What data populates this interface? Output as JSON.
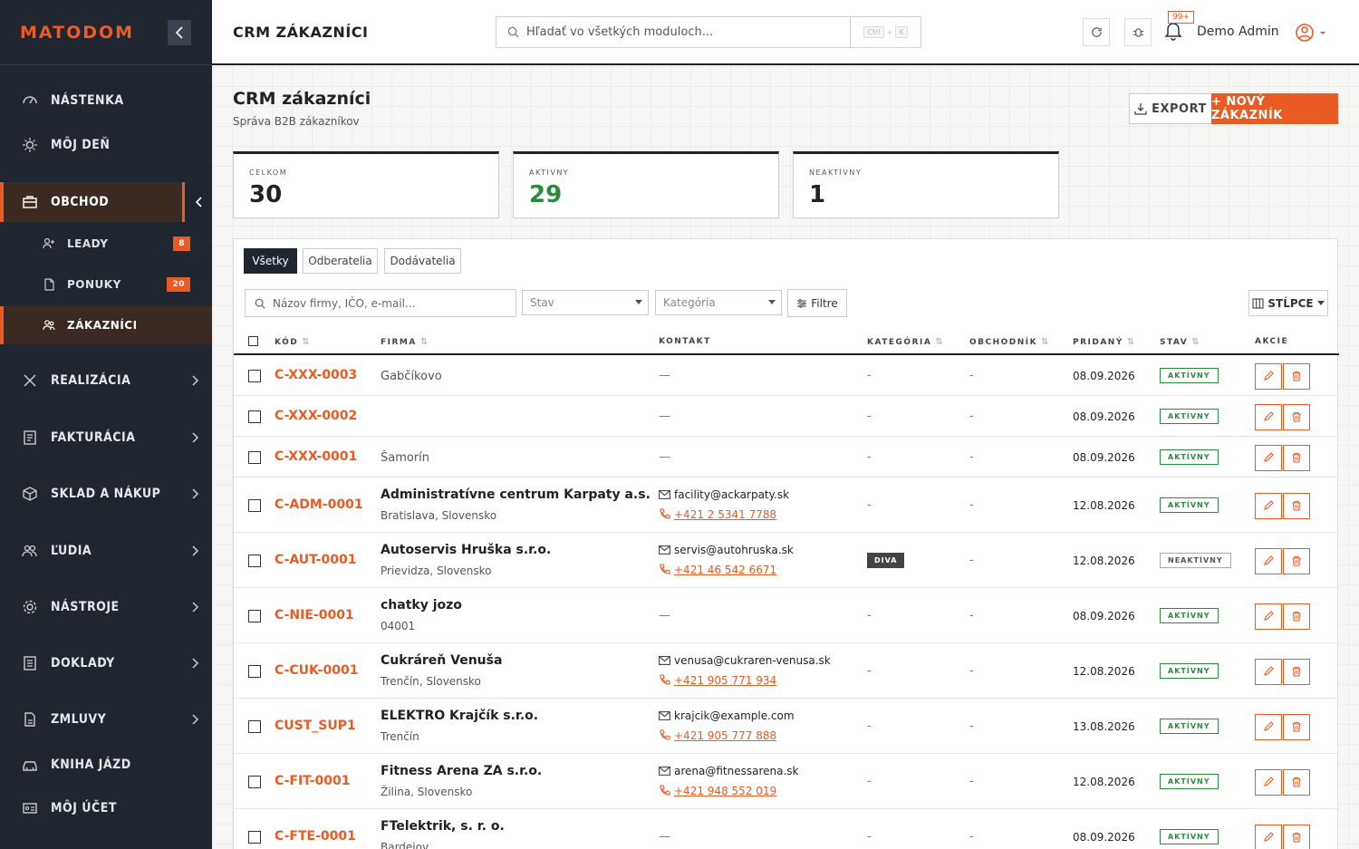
{
  "app": {
    "logo": "MATODOM",
    "topbar_title": "CRM ZÁKAZNÍCI",
    "search_placeholder": "Hľadať vo všetkých moduloch...",
    "shortcut_ctrl": "Ctrl",
    "shortcut_plus": "+",
    "shortcut_key": "K",
    "notifications": "99+",
    "user_name": "Demo Admin"
  },
  "sidebar": {
    "items": [
      {
        "label": "NÁSTENKA",
        "icon": "dashboard-icon"
      },
      {
        "label": "MÔJ DEŇ",
        "icon": "sun-icon"
      },
      {
        "label": "OBCHOD",
        "icon": "briefcase-icon"
      },
      {
        "label": "REALIZÁCIA",
        "icon": "tools-icon"
      },
      {
        "label": "FAKTURÁCIA",
        "icon": "invoice-icon"
      },
      {
        "label": "SKLAD A NÁKUP",
        "icon": "box-icon"
      },
      {
        "label": "ĽUDIA",
        "icon": "people-icon"
      },
      {
        "label": "NÁSTROJE",
        "icon": "gear-icon"
      },
      {
        "label": "DOKLADY",
        "icon": "document-icon"
      },
      {
        "label": "ZMLUVY",
        "icon": "contract-icon"
      },
      {
        "label": "KNIHA JÁZD",
        "icon": "car-icon"
      },
      {
        "label": "MÔJ ÚČET",
        "icon": "id-card-icon"
      }
    ],
    "sub_items": [
      {
        "label": "LEADY",
        "badge": "8"
      },
      {
        "label": "PONUKY",
        "badge": "20"
      },
      {
        "label": "ZÁKAZNÍCI"
      }
    ]
  },
  "header": {
    "title": "CRM zákazníci",
    "subtitle": "Správa B2B zákazníkov",
    "export_label": "EXPORT",
    "new_label": "+ NOVÝ ZÁKAZNÍK"
  },
  "stats": [
    {
      "label": "CELKOM",
      "value": "30",
      "color": "#222222"
    },
    {
      "label": "AKTÍVNY",
      "value": "29",
      "color": "#2b8a3e"
    },
    {
      "label": "NEAKTÍVNY",
      "value": "1",
      "color": "#222222"
    }
  ],
  "tabs": [
    "Všetky",
    "Odberatelia",
    "Dodávatelia"
  ],
  "filters": {
    "search_placeholder": "Názov firmy, IČO, e-mail...",
    "status_placeholder": "Stav",
    "category_placeholder": "Kategória",
    "filter_label": "Filtre",
    "columns_label": "STĹPCE"
  },
  "table": {
    "headers": [
      "KÓD",
      "FIRMA",
      "KONTAKT",
      "KATEGÓRIA",
      "OBCHODNÍK",
      "PRIDANÝ",
      "STAV",
      "AKCIE"
    ],
    "rows": [
      {
        "code": "C-XXX-0003",
        "firm": "Gabčíkovo",
        "firm_sub": "",
        "email": "",
        "phone": "",
        "contact": "—",
        "category": "-",
        "agent": "-",
        "date": "08.09.2026",
        "status": "AKTÍVNY"
      },
      {
        "code": "C-XXX-0002",
        "firm": "",
        "firm_sub": "",
        "email": "",
        "phone": "",
        "contact": "—",
        "category": "-",
        "agent": "-",
        "date": "08.09.2026",
        "status": "AKTÍVNY"
      },
      {
        "code": "C-XXX-0001",
        "firm": "Šamorín",
        "firm_sub": "",
        "email": "",
        "phone": "",
        "contact": "—",
        "category": "-",
        "agent": "-",
        "date": "08.09.2026",
        "status": "AKTÍVNY"
      },
      {
        "code": "C-ADM-0001",
        "firm": "Administratívne centrum Karpaty a.s.",
        "firm_sub": "Bratislava, Slovensko",
        "email": "facility@ackarpaty.sk",
        "phone": "+421 2 5341 7788",
        "contact": "",
        "category": "-",
        "agent": "-",
        "date": "12.08.2026",
        "status": "AKTÍVNY"
      },
      {
        "code": "C-AUT-0001",
        "firm": "Autoservis Hruška s.r.o.",
        "firm_sub": "Prievidza, Slovensko",
        "email": "servis@autohruska.sk",
        "phone": "+421 46 542 6671",
        "contact": "",
        "category": "DIVA",
        "agent": "-",
        "date": "12.08.2026",
        "status": "NEAKTÍVNY"
      },
      {
        "code": "C-NIE-0001",
        "firm": "chatky jozo",
        "firm_sub": "04001",
        "email": "",
        "phone": "",
        "contact": "—",
        "category": "-",
        "agent": "-",
        "date": "08.09.2026",
        "status": "AKTÍVNY"
      },
      {
        "code": "C-CUK-0001",
        "firm": "Cukráreň Venuša",
        "firm_sub": "Trenčín, Slovensko",
        "email": "venusa@cukraren-venusa.sk",
        "phone": "+421 905 771 934",
        "contact": "",
        "category": "-",
        "agent": "-",
        "date": "12.08.2026",
        "status": "AKTÍVNY"
      },
      {
        "code": "CUST_SUP1",
        "firm": "ELEKTRO Krajčík s.r.o.",
        "firm_sub": "Trenčín",
        "email": "krajcik@example.com",
        "phone": "+421 905 777 888",
        "contact": "",
        "category": "-",
        "agent": "-",
        "date": "13.08.2026",
        "status": "AKTÍVNY"
      },
      {
        "code": "C-FIT-0001",
        "firm": "Fitness Arena ZA s.r.o.",
        "firm_sub": "Žilina, Slovensko",
        "email": "arena@fitnessarena.sk",
        "phone": "+421 948 552 019",
        "contact": "",
        "category": "-",
        "agent": "-",
        "date": "12.08.2026",
        "status": "AKTÍVNY"
      },
      {
        "code": "C-FTE-0001",
        "firm": "FTelektrik, s. r. o.",
        "firm_sub": "Bardejov",
        "email": "",
        "phone": "",
        "contact": "—",
        "category": "-",
        "agent": "-",
        "date": "08.09.2026",
        "status": "AKTÍVNY"
      }
    ]
  },
  "colors": {
    "accent": "#ea5a23",
    "sidebar": "#1f2630",
    "active_status": "#2b8a3e"
  }
}
